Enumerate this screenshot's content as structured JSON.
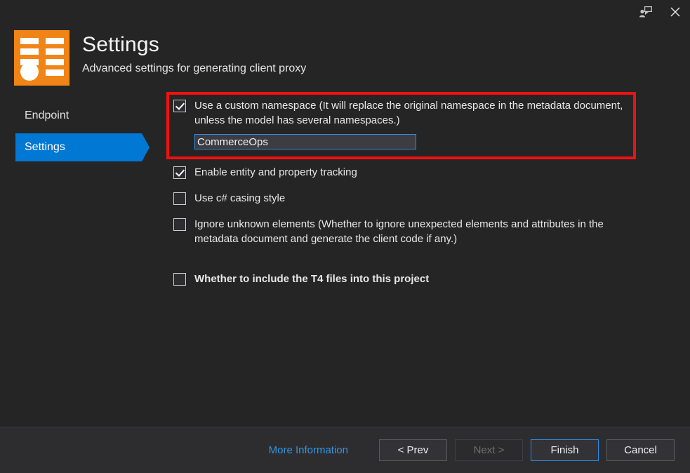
{
  "titlebar": {
    "feedback_icon": "feedback-person-speech-bubble-icon",
    "close_icon": "close-icon",
    "close_glyph": "✕"
  },
  "header": {
    "icon": "settings-list-icon",
    "title": "Settings",
    "subtitle": "Advanced settings for generating client proxy"
  },
  "sidebar": {
    "items": [
      {
        "label": "Endpoint",
        "active": false
      },
      {
        "label": "Settings",
        "active": true
      }
    ]
  },
  "main": {
    "options": [
      {
        "label": "Use a custom namespace (It will replace the original namespace in the metadata document, unless the model has several namespaces.)",
        "checked": true,
        "bold": false
      },
      {
        "label": "Enable entity and property tracking",
        "checked": true,
        "bold": false
      },
      {
        "label": "Use c# casing style",
        "checked": false,
        "bold": false
      },
      {
        "label": "Ignore unknown elements (Whether to ignore unexpected elements and attributes in the metadata document and generate the client code if any.)",
        "checked": false,
        "bold": false
      },
      {
        "label": "Whether to include the T4 files into this project",
        "checked": false,
        "bold": true
      }
    ],
    "namespace_input": {
      "value": "CommerceOps",
      "placeholder": ""
    }
  },
  "footer": {
    "more_information": "More Information",
    "prev_label": "< Prev",
    "next_label": "Next >",
    "finish_label": "Finish",
    "cancel_label": "Cancel"
  },
  "colors": {
    "accent_blue": "#0078d4",
    "link_blue": "#3196e0",
    "focus_blue": "#2d8ee0",
    "icon_orange": "#f18417",
    "highlight_red": "#ee1111",
    "window_bg": "#252526",
    "footer_bg": "#2d2d30"
  }
}
